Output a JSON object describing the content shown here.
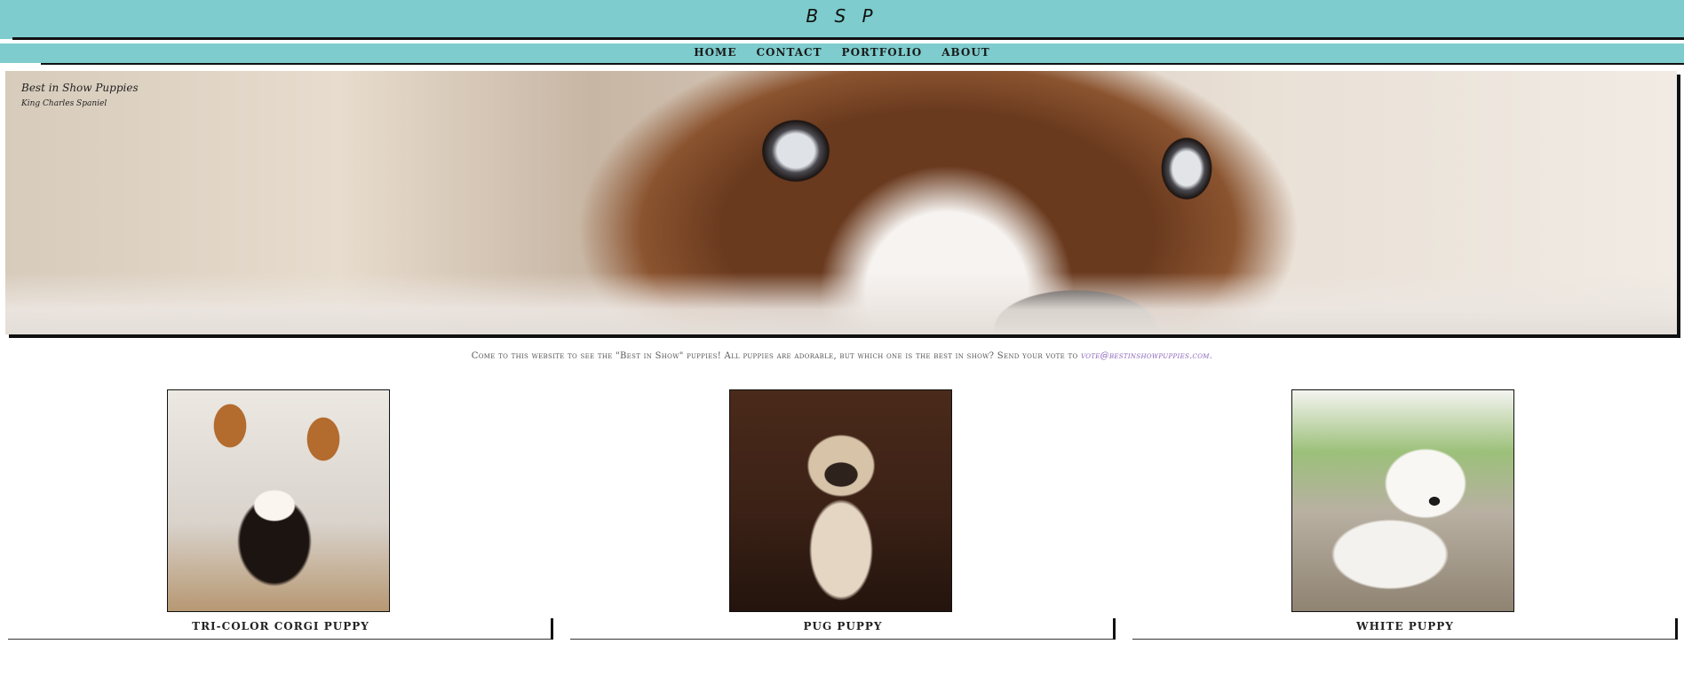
{
  "header": {
    "logo": "B S P"
  },
  "nav": {
    "items": [
      {
        "label": "HOME"
      },
      {
        "label": "CONTACT"
      },
      {
        "label": "PORTFOLIO"
      },
      {
        "label": "ABOUT"
      }
    ]
  },
  "hero": {
    "title": "Best in Show Puppies",
    "subtitle": "King Charles Spaniel"
  },
  "intro": {
    "text": "Come to this website to see the \"Best in Show\" puppies! All puppies are adorable, but which one is the best in show? Send your vote to ",
    "email": "vote@bestinshowpuppies.com."
  },
  "gallery": [
    {
      "label": "TRI-COLOR CORGI PUPPY"
    },
    {
      "label": "PUG PUPPY"
    },
    {
      "label": "WHITE PUPPY"
    }
  ]
}
